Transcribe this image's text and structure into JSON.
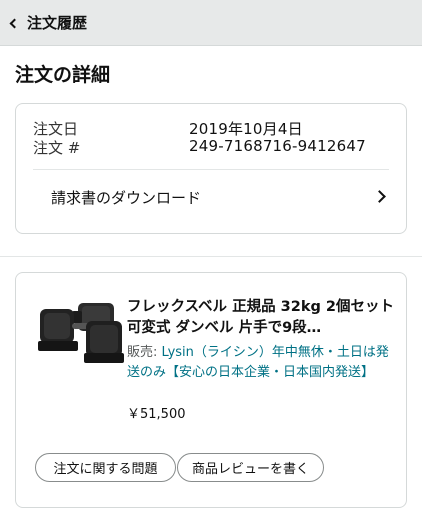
{
  "header": {
    "back_label": "注文履歴"
  },
  "page": {
    "title": "注文の詳細"
  },
  "order": {
    "date_label": "注文日",
    "date_value": "2019年10月4日",
    "number_label": "注文 #",
    "number_value": "249-7168716-9412647",
    "invoice_label": "請求書のダウンロード"
  },
  "item": {
    "title": "フレックスベル 正規品 32kg 2個セット 可変式 ダンベル 片手で9段…",
    "seller_prefix": "販売: ",
    "seller_name": "Lysin（ライシン）年中無休・土日は発送のみ【安心の日本企業・日本国内発送】",
    "price": "￥51,500",
    "thumbnail_icon": "dumbbell-icon"
  },
  "actions": {
    "problem_label": "注文に関する問題",
    "review_label": "商品レビューを書く"
  },
  "colors": {
    "topbar_bg": "#e7e9e9",
    "link": "#007185",
    "border": "#d5d9d9"
  }
}
